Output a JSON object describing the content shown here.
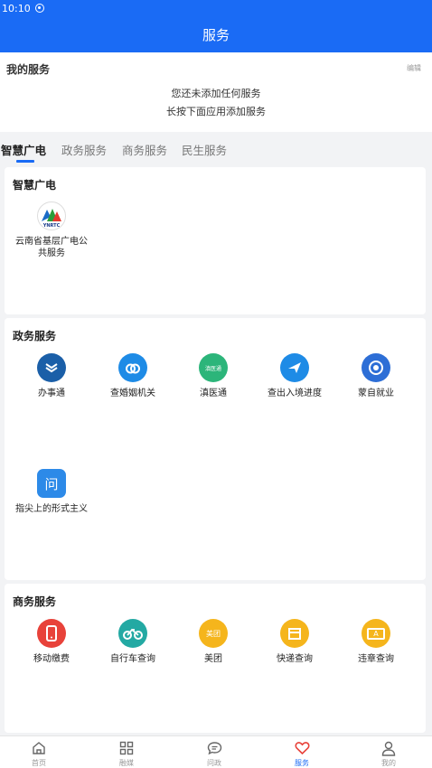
{
  "status_bar": {
    "time": "10:10"
  },
  "header": {
    "title": "服务"
  },
  "my_services": {
    "title": "我的服务",
    "edit_label": "编辑",
    "empty_line1": "您还未添加任何服务",
    "empty_line2": "长按下面应用添加服务"
  },
  "tabs": [
    {
      "label": "智慧广电"
    },
    {
      "label": "政务服务"
    },
    {
      "label": "商务服务"
    },
    {
      "label": "民生服务"
    }
  ],
  "sections": {
    "smart_broadcast": {
      "title": "智慧广电",
      "items": [
        {
          "label": "云南省基层广电公共服务",
          "icon": "ynrtc-logo-icon",
          "logo_text": "YNRTC"
        }
      ]
    },
    "government": {
      "title": "政务服务",
      "items": [
        {
          "label": "办事通",
          "icon": "banshitong-icon",
          "color": "#1b5fa8"
        },
        {
          "label": "查婚姻机关",
          "icon": "marriage-rings-icon",
          "color": "#1e8be6"
        },
        {
          "label": "滇医通",
          "icon": "dianyitong-icon",
          "color": "#2cb57a",
          "glyph": "滇医通"
        },
        {
          "label": "查出入境进度",
          "icon": "airplane-icon",
          "color": "#1e8be6"
        },
        {
          "label": "蒙自就业",
          "icon": "mengzi-employment-icon",
          "color": "#2d6ed6"
        },
        {
          "label": "指尖上的形式主义",
          "icon": "question-chat-icon",
          "color": "#2d8ae8",
          "glyph": "问"
        }
      ]
    },
    "business": {
      "title": "商务服务",
      "items": [
        {
          "label": "移动缴费",
          "icon": "mobile-payment-icon",
          "color": "#e8423a"
        },
        {
          "label": "自行车查询",
          "icon": "bicycle-icon",
          "color": "#23a9a3"
        },
        {
          "label": "美团",
          "icon": "meituan-icon",
          "color": "#f5b51c",
          "glyph": "美团"
        },
        {
          "label": "快递查询",
          "icon": "package-icon",
          "color": "#f5b51c"
        },
        {
          "label": "违章查询",
          "icon": "violation-icon",
          "color": "#f5b51c",
          "glyph": "A"
        }
      ]
    }
  },
  "bottom_nav": [
    {
      "label": "首页",
      "icon": "home-icon"
    },
    {
      "label": "融媒",
      "icon": "grid-icon"
    },
    {
      "label": "问政",
      "icon": "chat-icon"
    },
    {
      "label": "服务",
      "icon": "heart-icon",
      "active": true
    },
    {
      "label": "我的",
      "icon": "person-icon"
    }
  ],
  "colors": {
    "brand": "#1a6bf5",
    "text_muted": "#999999",
    "background": "#f2f3f5"
  }
}
